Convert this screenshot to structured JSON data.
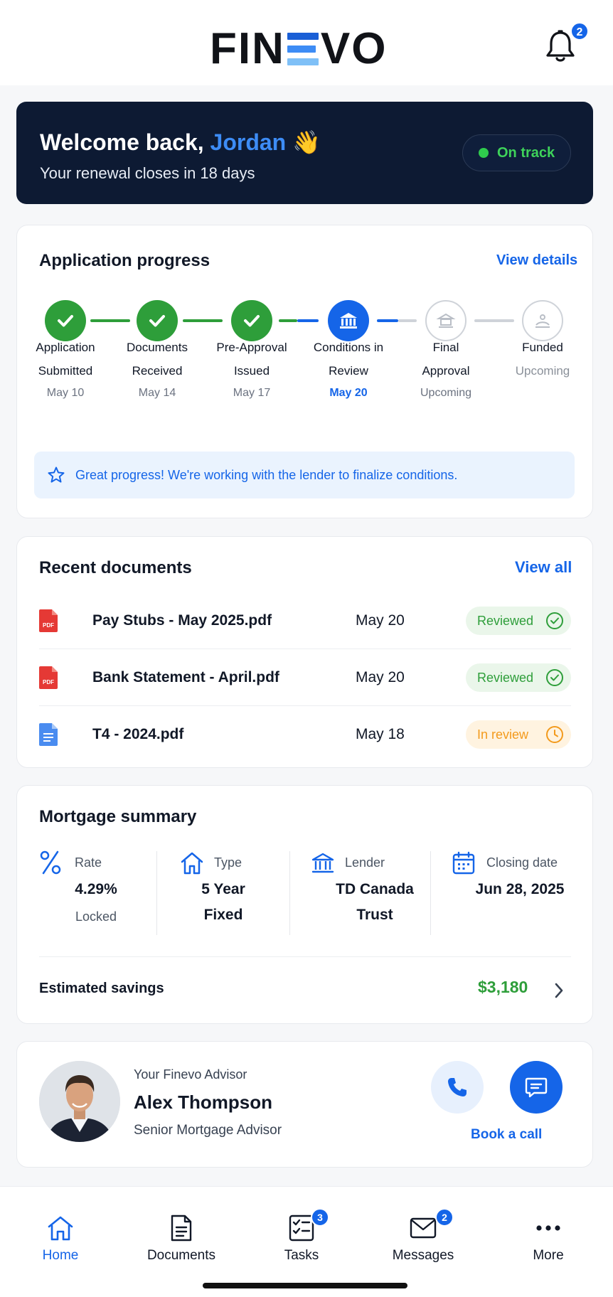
{
  "app": {
    "logo_left": "FIN",
    "logo_right": "VO",
    "notification_count": "2"
  },
  "welcome": {
    "greeting": "Welcome back, ",
    "name": "Jordan",
    "emoji": "👋",
    "subtitle": "Your renewal closes in 18 days",
    "status": "On track"
  },
  "progress": {
    "title": "Application progress",
    "link": "View details",
    "steps": [
      {
        "line1": "Application",
        "line2": "Submitted",
        "date": "May 10",
        "state": "done"
      },
      {
        "line1": "Documents",
        "line2": "Received",
        "date": "May 14",
        "state": "done"
      },
      {
        "line1": "Pre-Approval",
        "line2": "Issued",
        "date": "May 17",
        "state": "done"
      },
      {
        "line1": "Conditions in",
        "line2": "Review",
        "date": "May 20",
        "state": "current"
      },
      {
        "line1": "Final",
        "line2": "Approval",
        "date": "Upcoming",
        "state": "upcoming"
      },
      {
        "line1": "Funded",
        "line2": "Upcoming",
        "date": "",
        "state": "upcoming"
      }
    ],
    "notice": "Great progress! We're working with the lender to finalize conditions."
  },
  "documents": {
    "title": "Recent documents",
    "link": "View all",
    "items": [
      {
        "name": "Pay Stubs - May 2025.pdf",
        "date": "May 20",
        "status": "Reviewed",
        "type": "pdf"
      },
      {
        "name": "Bank Statement - April.pdf",
        "date": "May 20",
        "status": "Reviewed",
        "type": "pdf"
      },
      {
        "name": "T4 - 2024.pdf",
        "date": "May 18",
        "status": "In review",
        "type": "doc"
      }
    ]
  },
  "summary": {
    "title": "Mortgage summary",
    "rate_label": "Rate",
    "rate_value": "4.29%",
    "rate_note": "Locked",
    "type_label": "Type",
    "type_line1": "5 Year",
    "type_line2": "Fixed",
    "lender_label": "Lender",
    "lender_line1": "TD Canada",
    "lender_line2": "Trust",
    "closing_label": "Closing date",
    "closing_value": "Jun 28, 2025",
    "savings_label": "Estimated savings",
    "savings_value": "$3,180"
  },
  "advisor": {
    "pre": "Your Finevo Advisor",
    "name": "Alex Thompson",
    "role": "Senior Mortgage Advisor",
    "book": "Book a call"
  },
  "tabs": {
    "home": "Home",
    "documents": "Documents",
    "tasks": "Tasks",
    "tasks_badge": "3",
    "messages": "Messages",
    "messages_badge": "2",
    "more": "More"
  },
  "colors": {
    "accent": "#1565e8",
    "success": "#2e9e3a",
    "warning": "#f39a1c",
    "navy": "#0d1a33"
  }
}
